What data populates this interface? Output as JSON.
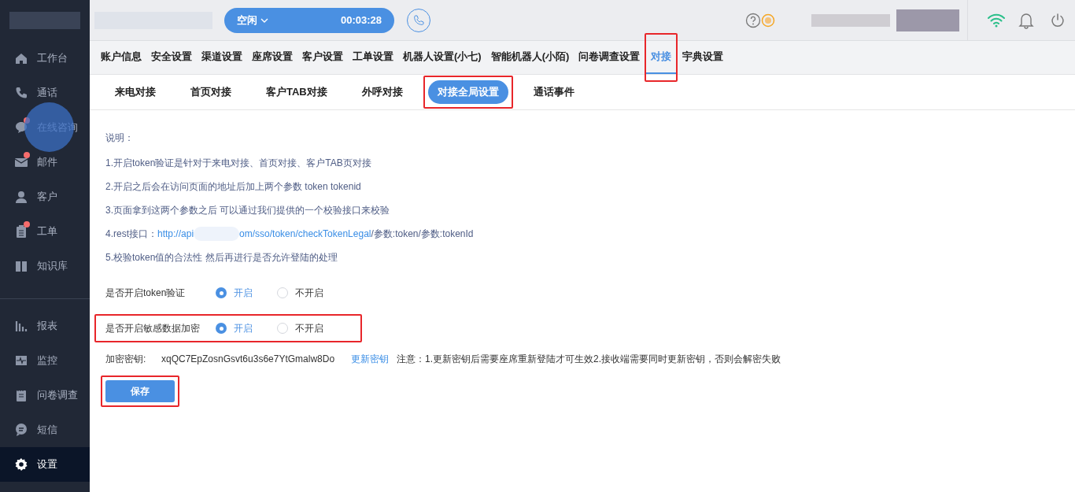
{
  "top_bar": {
    "status": "空闲",
    "timer": "00:03:28"
  },
  "sidebar": {
    "items": [
      {
        "label": "工作台",
        "dot": false,
        "selected": false
      },
      {
        "label": "通话",
        "dot": false,
        "selected": false
      },
      {
        "label": "在线咨询",
        "dot": true,
        "selected": false
      },
      {
        "label": "邮件",
        "dot": true,
        "selected": false
      },
      {
        "label": "客户",
        "dot": false,
        "selected": false
      },
      {
        "label": "工单",
        "dot": true,
        "selected": false
      },
      {
        "label": "知识库",
        "dot": false,
        "selected": false
      }
    ],
    "bottom_items": [
      {
        "label": "报表",
        "selected": false
      },
      {
        "label": "监控",
        "selected": false
      },
      {
        "label": "问卷调查",
        "selected": false
      },
      {
        "label": "短信",
        "selected": false
      },
      {
        "label": "设置",
        "selected": true
      }
    ]
  },
  "tabs": [
    {
      "label": "账户信息",
      "selected": false,
      "highlighted": false
    },
    {
      "label": "安全设置",
      "selected": false,
      "highlighted": false
    },
    {
      "label": "渠道设置",
      "selected": false,
      "highlighted": false
    },
    {
      "label": "座席设置",
      "selected": false,
      "highlighted": false
    },
    {
      "label": "客户设置",
      "selected": false,
      "highlighted": false
    },
    {
      "label": "工单设置",
      "selected": false,
      "highlighted": false
    },
    {
      "label": "机器人设置(小七)",
      "selected": false,
      "highlighted": false
    },
    {
      "label": "智能机器人(小陌)",
      "selected": false,
      "highlighted": false
    },
    {
      "label": "问卷调查设置",
      "selected": false,
      "highlighted": false
    },
    {
      "label": "对接",
      "selected": true,
      "highlighted": true
    },
    {
      "label": "宇典设置",
      "selected": false,
      "highlighted": false
    }
  ],
  "sub_tabs": [
    {
      "label": "来电对接",
      "selected": false,
      "highlighted": false
    },
    {
      "label": "首页对接",
      "selected": false,
      "highlighted": false
    },
    {
      "label": "客户TAB对接",
      "selected": false,
      "highlighted": false
    },
    {
      "label": "外呼对接",
      "selected": false,
      "highlighted": false
    },
    {
      "label": "对接全局设置",
      "selected": true,
      "highlighted": true
    },
    {
      "label": "通话事件",
      "selected": false,
      "highlighted": false
    }
  ],
  "notes": {
    "title": "说明：",
    "lines": [
      {
        "kind": "text",
        "text": "1.开启token验证是针对于来电对接、首页对接、客户TAB页对接"
      },
      {
        "kind": "text",
        "text": "2.开启之后会在访问页面的地址后加上两个参数 token tokenid"
      },
      {
        "kind": "text",
        "text": "3.页面拿到这两个参数之后 可以通过我们提供的一个校验接口来校验"
      },
      {
        "kind": "link",
        "prefix": "4.rest接口：",
        "link_start": "http://api",
        "link_end": "om/sso/token/checkTokenLegal",
        "suffix": "/参数:token/参数:tokenId"
      },
      {
        "kind": "text",
        "text": "5.校验token值的合法性 然后再进行是否允许登陆的处理"
      }
    ]
  },
  "settings": [
    {
      "label": "是否开启token验证",
      "highlighted": false,
      "options": [
        {
          "label": "开启",
          "selected": true
        },
        {
          "label": "不开启",
          "selected": false
        }
      ]
    },
    {
      "label": "是否开启敏感数据加密",
      "highlighted": true,
      "options": [
        {
          "label": "开启",
          "selected": true
        },
        {
          "label": "不开启",
          "selected": false
        }
      ]
    }
  ],
  "key_row": {
    "label": "加密密钥:",
    "value": "xqQC7EpZosnGsvt6u3s6e7YtGmalw8Do",
    "action": "更新密钥",
    "note": "注意：1.更新密钥后需要座席重新登陆才可生效2.接收端需要同时更新密钥，否则会解密失败"
  },
  "save_button": {
    "label": "保存",
    "highlighted": true
  }
}
